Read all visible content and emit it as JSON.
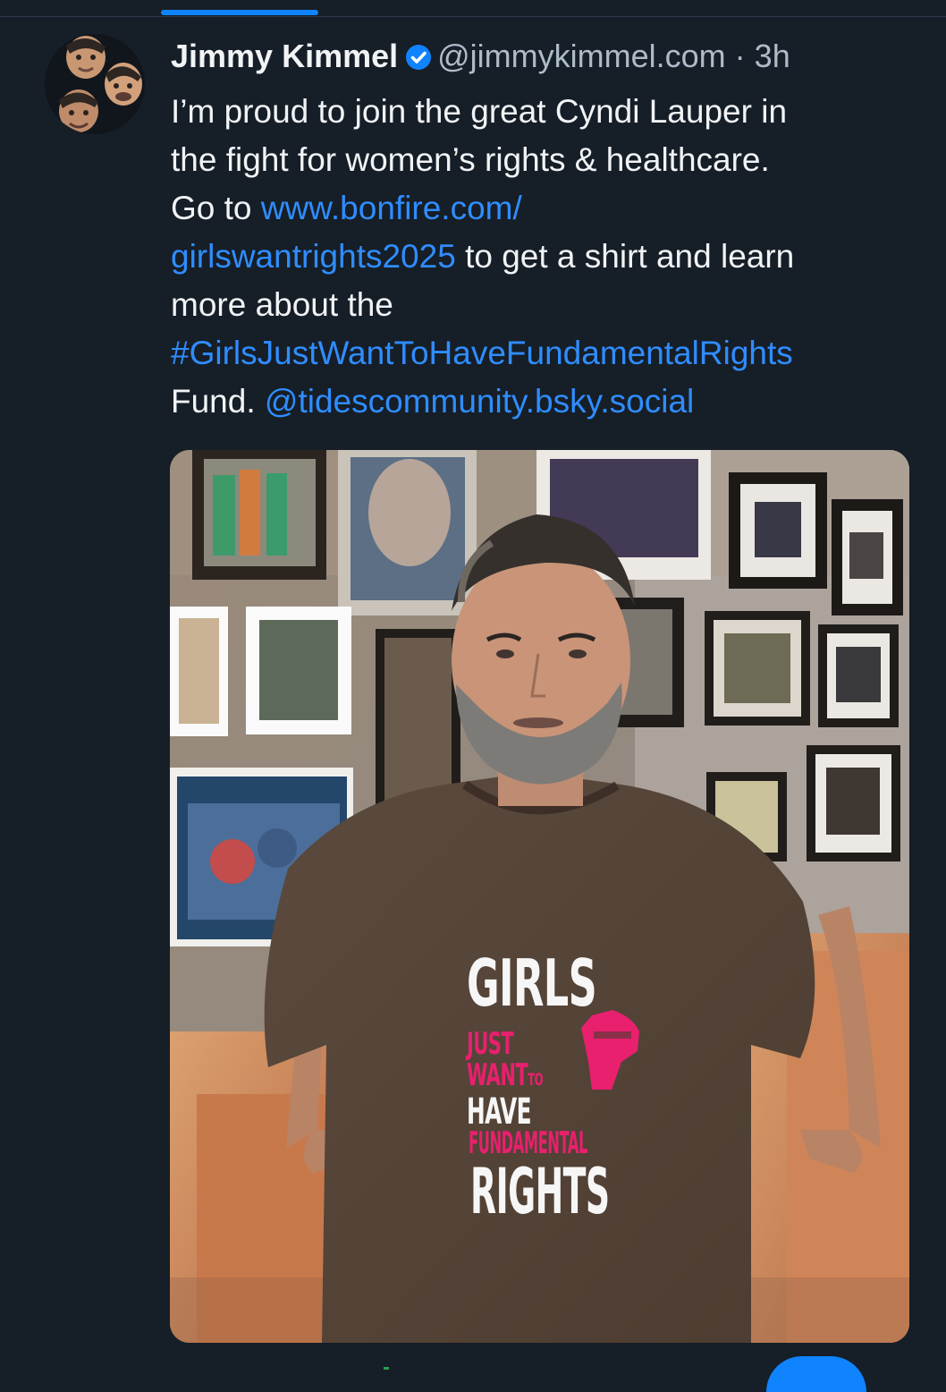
{
  "post": {
    "author_name": "Jimmy Kimmel",
    "handle": "@jimmykimmel.com",
    "separator": "·",
    "time": "3h",
    "verified_icon": "verified-check-icon",
    "text_lines": {
      "l1": "I’m proud to join the great Cyndi Lauper in",
      "l2": "the fight for women’s rights & healthcare.",
      "l3_prefix": "Go to ",
      "l3_link": "www.bonfire.com/",
      "l4_link": "girlswantrights2025",
      "l4_suffix": " to get a shirt and learn",
      "l5": "more about the",
      "l6_hashtag": "#GirlsJustWantToHaveFundamentalRights",
      "l7_prefix": "Fund. ",
      "l7_mention": "@tidescommunity.bsky.social"
    }
  },
  "image": {
    "shirt_lines": {
      "girls": "GIRLS",
      "just": "JUST",
      "want": "WANT",
      "to": "TO",
      "have": "HAVE",
      "fundamental": "FUNDAMENTAL",
      "rights": "RIGHTS"
    }
  },
  "colors": {
    "background": "#161e27",
    "link": "#2f8dff",
    "accent": "#1083fe",
    "muted_text": "#aebbc9",
    "shirt_pink": "#e8206e"
  }
}
